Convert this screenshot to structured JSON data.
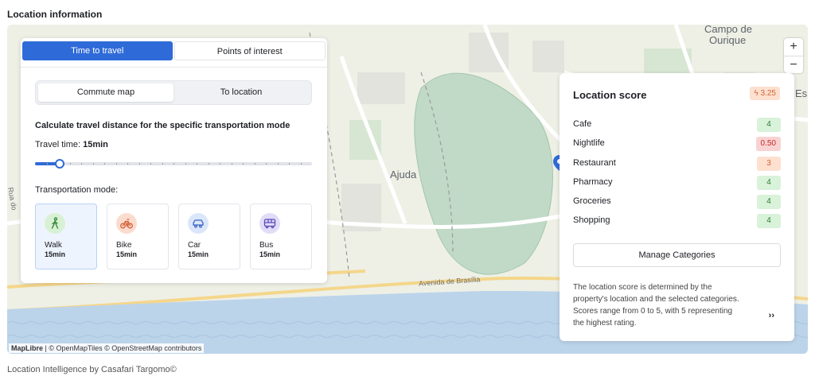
{
  "section_title": "Location information",
  "map": {
    "labels": {
      "campo_de_ourique_1": "Campo de",
      "campo_de_ourique_2": "Ourique",
      "ajuda": "Ajuda",
      "es": "Es",
      "avenida": "Avenida de Brasília",
      "rua_left": "Rua do"
    },
    "attribution_brand": "MapLibre",
    "attribution_text": " | © OpenMapTiles © OpenStreetMap contributors",
    "zoom_in": "+",
    "zoom_out": "−"
  },
  "left_panel": {
    "tabs": [
      "Time to travel",
      "Points of interest"
    ],
    "sub_tabs": [
      "Commute map",
      "To location"
    ],
    "calc_title": "Calculate travel distance for the specific transportation mode",
    "travel_time_label": "Travel time: ",
    "travel_time_value": "15min",
    "slider_fraction": 0.09,
    "mode_label": "Transportation mode:",
    "modes": [
      {
        "name": "Walk",
        "time": "15min",
        "icon": "walk-icon",
        "color": "#d8f1d5",
        "stroke": "#3b8a3a",
        "active": true
      },
      {
        "name": "Bike",
        "time": "15min",
        "icon": "bike-icon",
        "color": "#fcdccf",
        "stroke": "#d4633a"
      },
      {
        "name": "Car",
        "time": "15min",
        "icon": "car-icon",
        "color": "#dbe6fb",
        "stroke": "#3b66c4"
      },
      {
        "name": "Bus",
        "time": "15min",
        "icon": "bus-icon",
        "color": "#e1dcf7",
        "stroke": "#5d4cb8"
      }
    ]
  },
  "right_panel": {
    "title": "Location score",
    "score": "3.25",
    "score_icon": "lightning-icon",
    "rows": [
      {
        "name": "Cafe",
        "value": "4",
        "bg": "#d9f2da",
        "fg": "#2e7d32"
      },
      {
        "name": "Nightlife",
        "value": "0.50",
        "bg": "#f9d3d3",
        "fg": "#c62828"
      },
      {
        "name": "Restaurant",
        "value": "3",
        "bg": "#fde0cf",
        "fg": "#d4633a"
      },
      {
        "name": "Pharmacy",
        "value": "4",
        "bg": "#d9f2da",
        "fg": "#2e7d32"
      },
      {
        "name": "Groceries",
        "value": "4",
        "bg": "#d9f2da",
        "fg": "#2e7d32"
      },
      {
        "name": "Shopping",
        "value": "4",
        "bg": "#d9f2da",
        "fg": "#2e7d32"
      }
    ],
    "manage_button": "Manage Categories",
    "description": "The location score is determined by the property's location and the selected categories. Scores range from 0 to 5, with 5 representing the highest rating.",
    "more": "››"
  },
  "footer": "Location Intelligence by Casafari Targomo©",
  "colors": {
    "accent": "#2f6bd8",
    "score_badge_bg": "#fde0cf",
    "score_badge_fg": "#d4633a"
  }
}
